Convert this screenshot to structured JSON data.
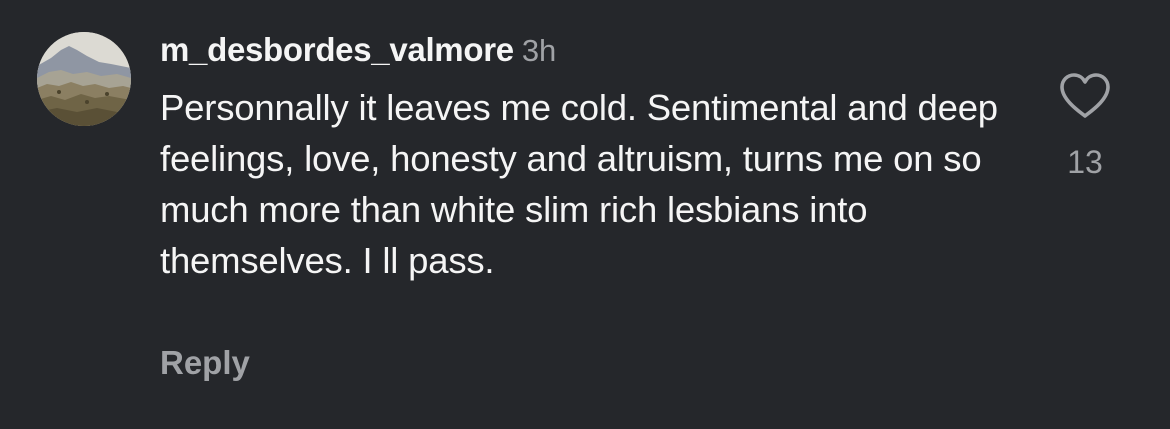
{
  "comment": {
    "username": "m_desbordes_valmore",
    "timestamp": "3h",
    "text": "Personnally it leaves me cold. Sentimental and deep feelings, love, honesty and altruism, turns me on so much more than white slim rich lesbians into themselves. I ll pass.",
    "reply_label": "Reply",
    "like_count": "13",
    "avatar_icon": "landscape-avatar-icon",
    "like_icon": "heart-outline-icon"
  },
  "colors": {
    "background": "#25272b",
    "primary_text": "#f5f5f5",
    "secondary_text": "#a0a2a6"
  }
}
